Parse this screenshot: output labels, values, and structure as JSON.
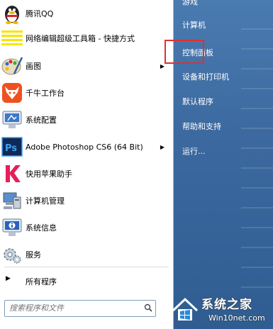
{
  "left_items": [
    {
      "label": "腾讯QQ",
      "icon": "qq-penguin-icon",
      "submenu": false
    },
    {
      "label": "网络编辑超级工具箱 - 快捷方式",
      "icon": "toolbox-shortcut-icon",
      "submenu": false
    },
    {
      "label": "画图",
      "icon": "paint-palette-icon",
      "submenu": true
    },
    {
      "label": "千牛工作台",
      "icon": "qianniu-icon",
      "submenu": false
    },
    {
      "label": "系统配置",
      "icon": "system-config-icon",
      "submenu": false
    },
    {
      "label": "Adobe Photoshop CS6 (64 Bit)",
      "icon": "photoshop-icon",
      "submenu": true
    },
    {
      "label": "快用苹果助手",
      "icon": "kuaiyong-icon",
      "submenu": false
    },
    {
      "label": "计算机管理",
      "icon": "computer-management-icon",
      "submenu": false
    },
    {
      "label": "系统信息",
      "icon": "system-info-icon",
      "submenu": false
    },
    {
      "label": "服务",
      "icon": "services-gear-icon",
      "submenu": false
    }
  ],
  "all_programs": "所有程序",
  "search": {
    "placeholder": "搜索程序和文件"
  },
  "right_items": [
    {
      "label": "游戏"
    },
    {
      "label": "计算机"
    },
    {
      "label": "控制面板"
    },
    {
      "label": "设备和打印机"
    },
    {
      "label": "默认程序"
    },
    {
      "label": "帮助和支持"
    },
    {
      "label": "运行..."
    }
  ],
  "watermark": {
    "title": "系统之家",
    "url": "Win10net.com"
  },
  "colors": {
    "highlight": "#e03030",
    "right_pane": "#3c6aa0"
  }
}
